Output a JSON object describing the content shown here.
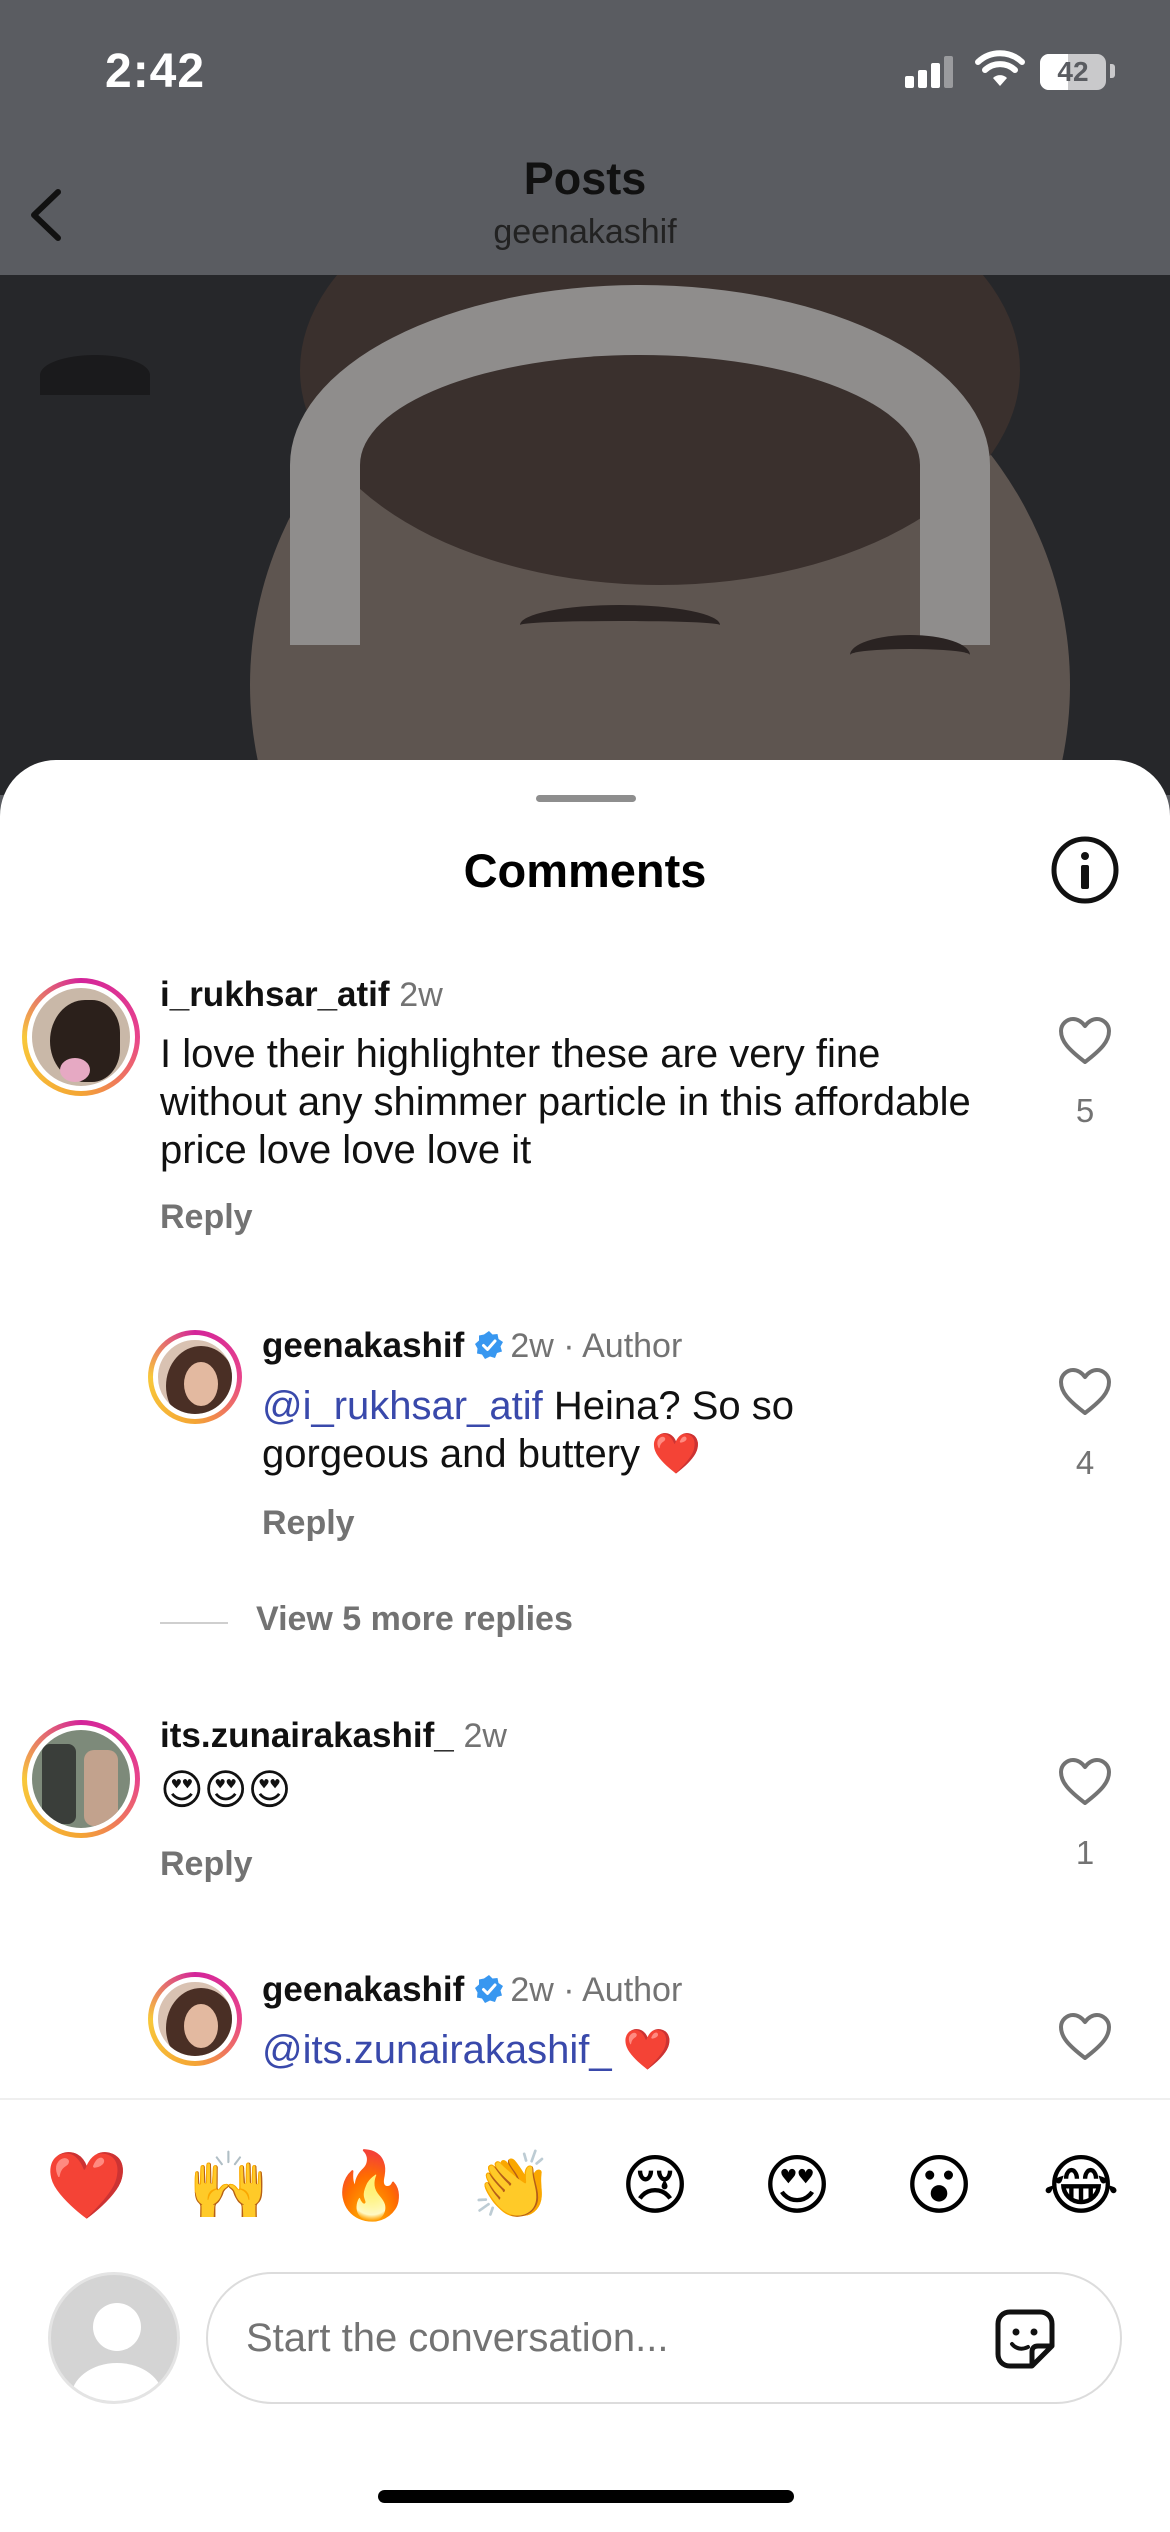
{
  "status_bar": {
    "time": "2:42",
    "battery": "42"
  },
  "nav": {
    "title": "Posts",
    "subtitle": "geenakashif"
  },
  "sheet": {
    "title": "Comments"
  },
  "comments": [
    {
      "username": "i_rukhsar_atif",
      "time": "2w",
      "text": "I love their highlighter these are very fine without any shimmer particle in this affordable price love love love it",
      "reply_label": "Reply",
      "likes": "5"
    },
    {
      "username": "geenakashif",
      "meta": "2w · Author",
      "mention": "@i_rukhsar_atif",
      "text": " Heina? So so gorgeous and buttery ❤️",
      "reply_label": "Reply",
      "likes": "4"
    },
    {
      "username": "its.zunairakashif_",
      "time": "2w",
      "text": "😍😍😍",
      "reply_label": "Reply",
      "likes": "1"
    },
    {
      "username": "geenakashif",
      "meta": "2w · Author",
      "mention": "@its.zunairakashif_",
      "text": " ❤️"
    }
  ],
  "view_more": "View 5 more replies",
  "quick_emojis": [
    "❤️",
    "🙌",
    "🔥",
    "👏",
    "😢",
    "😍",
    "😮",
    "😂"
  ],
  "composer": {
    "placeholder": "Start the conversation..."
  },
  "colors": {
    "mention": "#3949ab",
    "secondary_text": "#737373",
    "verified": "#3897f0",
    "story_ring": "#d3249a"
  }
}
